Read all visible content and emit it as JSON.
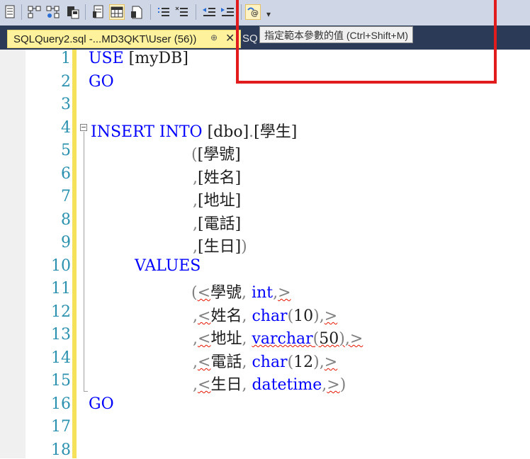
{
  "toolbar": {
    "buttons": [
      {
        "name": "results-to-text-icon"
      },
      {
        "name": "include-actual-plan-icon"
      },
      {
        "name": "client-statistics-icon"
      },
      {
        "name": "results-to-grid-icon"
      },
      {
        "name": "results-to-file-icon"
      },
      {
        "name": "query-options-icon"
      },
      {
        "name": "comment-out-icon"
      },
      {
        "name": "uncomment-icon"
      },
      {
        "name": "decrease-indent-icon"
      },
      {
        "name": "increase-indent-icon"
      },
      {
        "name": "specify-template-parameters-icon"
      }
    ],
    "overflow_label": "▾"
  },
  "tabs": {
    "active": {
      "title": "SQLQuery2.sql -...MD3QKT\\User (56))",
      "pin": "⊕",
      "close": "✕"
    },
    "inactive": {
      "title": "SQ"
    }
  },
  "tooltip": {
    "text": "指定範本參數的值 (Ctrl+Shift+M)"
  },
  "editor": {
    "line_numbers": [
      "1",
      "2",
      "3",
      "4",
      "5",
      "6",
      "7",
      "8",
      "9",
      "10",
      "11",
      "12",
      "13",
      "14",
      "15",
      "16",
      "17",
      "18"
    ],
    "lines": {
      "l1_kw": "USE",
      "l1_rest": " [myDB]",
      "l2_kw": "GO",
      "l4_kw": "INSERT INTO",
      "l4_rest": " [dbo]",
      "l4_dot": ".",
      "l4_tbl": "[學生]",
      "l5_paren": "(",
      "l5_col": "[學號]",
      "l6_comma": ",",
      "l6_col": "[姓名]",
      "l7_comma": ",",
      "l7_col": "[地址]",
      "l8_comma": ",",
      "l8_col": "[電話]",
      "l9_comma": ",",
      "l9_col": "[生日]",
      "l9_close": ")",
      "l10_kw": "VALUES",
      "l11_paren": "(",
      "l11_lt": "<",
      "l11_name": "學號",
      "l11_comma": ", ",
      "l11_type": "int",
      "l11_tail": ",",
      "l11_gt": ">",
      "l12_comma": ",",
      "l12_lt": "<",
      "l12_name": "姓名",
      "l12_sep": ", ",
      "l12_type": "char",
      "l12_open": "(",
      "l12_num": "10",
      "l12_close": ")",
      "l12_tail": ",",
      "l12_gt": ">",
      "l13_comma": ",",
      "l13_lt": "<",
      "l13_name": "地址",
      "l13_sep": ", ",
      "l13_type": "varchar",
      "l13_open": "(",
      "l13_num": "50",
      "l13_close": ")",
      "l13_tail": ",",
      "l13_gt": ">",
      "l14_comma": ",",
      "l14_lt": "<",
      "l14_name": "電話",
      "l14_sep": ", ",
      "l14_type": "char",
      "l14_open": "(",
      "l14_num": "12",
      "l14_close": ")",
      "l14_tail": ",",
      "l14_gt": ">",
      "l15_comma": ",",
      "l15_lt": "<",
      "l15_name": "生日",
      "l15_sep": ", ",
      "l15_type": "datetime",
      "l15_tail": ",",
      "l15_gt": ">",
      "l15_close": ")",
      "l16_kw": "GO"
    }
  }
}
